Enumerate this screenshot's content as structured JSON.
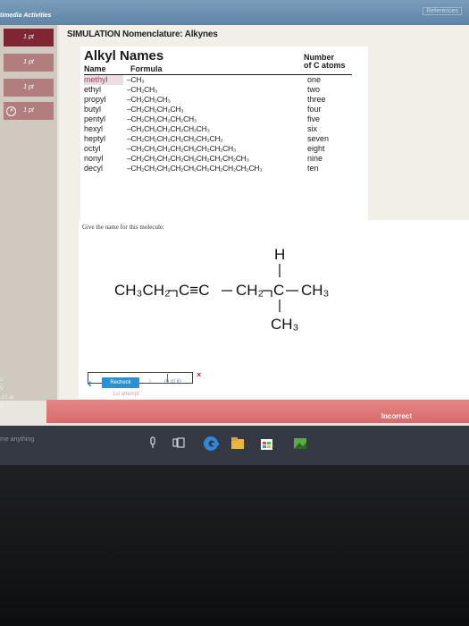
{
  "colors": {
    "topbar": "#6c90b1",
    "points_dark": "#7f2534",
    "points_light": "#b27d7e",
    "recheck": "#2a92d2",
    "incorrect_banner": "#dd7474",
    "wrong_mark": "#cc2222",
    "taskbar": "#343944"
  },
  "window": {
    "app_name": "timedia Activities",
    "references_label": "References"
  },
  "sidebar": {
    "points": [
      "1 pt",
      "1 pt",
      "1 pt",
      "1 pt"
    ],
    "wrong_icon": "x-circle-icon",
    "bottom_left": "s:",
    "bottom_mid": "5",
    "bottom_date": "-21 at",
    "bottom_last": "M"
  },
  "simulation": {
    "title": "SIMULATION Nomenclature: Alkynes",
    "table": {
      "heading": "Alkyl Names",
      "name_header": "Name",
      "formula_header": "Formula",
      "count_header_1": "Number",
      "count_header_2": "of C atoms",
      "rows": [
        {
          "name": "methyl",
          "formula": "–CH₃",
          "count": "one"
        },
        {
          "name": "ethyl",
          "formula": "–CH₂CH₃",
          "count": "two"
        },
        {
          "name": "propyl",
          "formula": "–CH₂CH₂CH₃",
          "count": "three"
        },
        {
          "name": "butyl",
          "formula": "–CH₂CH₂CH₂CH₃",
          "count": "four"
        },
        {
          "name": "pentyl",
          "formula": "–CH₂CH₂CH₂CH₂CH₃",
          "count": "five"
        },
        {
          "name": "hexyl",
          "formula": "–CH₂CH₂CH₂CH₂CH₂CH₃",
          "count": "six"
        },
        {
          "name": "heptyl",
          "formula": "–CH₂CH₂CH₂CH₂CH₂CH₂CH₃",
          "count": "seven"
        },
        {
          "name": "octyl",
          "formula": "–CH₂CH₂CH₂CH₂CH₂CH₂CH₂CH₃",
          "count": "eight"
        },
        {
          "name": "nonyl",
          "formula": "–CH₂CH₂CH₂CH₂CH₂CH₂CH₂CH₂CH₃",
          "count": "nine"
        },
        {
          "name": "decyl",
          "formula": "–CH₂CH₂CH₂CH₂CH₂CH₂CH₂CH₂CH₂CH₃",
          "count": "ten"
        }
      ]
    }
  },
  "question": {
    "prompt": "Give the name for this molecule:",
    "molecule": {
      "left_chain": "CH₃CH₂",
      "triple_bond": "C≡C",
      "ch2": "CH₂",
      "center_c": "C",
      "right_ch3": "CH₃",
      "top_h": "H",
      "bottom_ch3": "CH₃"
    },
    "answer_value": "",
    "wrong_mark": "×"
  },
  "controls": {
    "back_label": "‹",
    "recheck_label": "Recheck",
    "next_label": "›",
    "counter": "(6 of 8)",
    "attempt": "1st attempt"
  },
  "banner": {
    "label": "Incorrect"
  },
  "taskbar": {
    "search_placeholder": "me anything",
    "icons": [
      "microphone-icon",
      "task-view-icon",
      "edge-icon",
      "file-explorer-icon",
      "store-icon",
      "photos-icon"
    ]
  }
}
